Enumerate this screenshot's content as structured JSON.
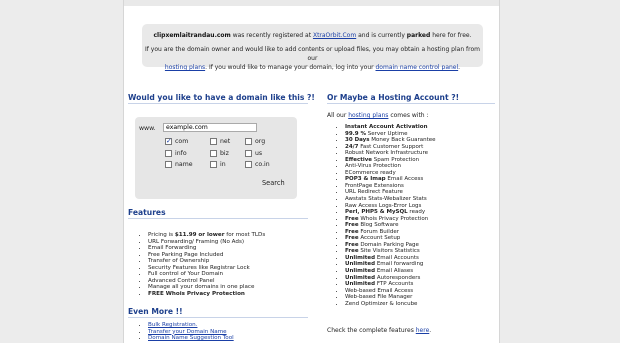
{
  "notice": {
    "domain": "clipxemlaitrandau.com",
    "text1": " was recently registered at ",
    "registrar": "XtraOrbit.Com",
    "text2": " and is currently ",
    "parked": "parked",
    "text3": " here for free.",
    "line2a": "If you are the domain owner and would like to add contents or upload files, you may obtain a hosting plan from our",
    "hosting_link": "hosting plans",
    "line3a": ". If you would like to manage your domain, log into your ",
    "control_link": "domain name control panel",
    "line3b": "."
  },
  "domain_search": {
    "heading": "Would you like to have a domain like this ?!",
    "www_label": "www.",
    "input_value": "example.com",
    "tlds": [
      {
        "label": "com",
        "checked": true
      },
      {
        "label": "net",
        "checked": false
      },
      {
        "label": "org",
        "checked": false
      },
      {
        "label": "info",
        "checked": false
      },
      {
        "label": "biz",
        "checked": false
      },
      {
        "label": "us",
        "checked": false
      },
      {
        "label": "name",
        "checked": false
      },
      {
        "label": "in",
        "checked": false
      },
      {
        "label": "co.in",
        "checked": false
      }
    ],
    "search_label": "Search"
  },
  "features": {
    "heading": "Features",
    "items": [
      {
        "pre": "Pricing is ",
        "bold": "$11.99 or lower",
        "post": " for most TLDs"
      },
      {
        "pre": "URL Forwarding/ Framing (No Ads)",
        "bold": "",
        "post": ""
      },
      {
        "pre": "Email Forwarding",
        "bold": "",
        "post": ""
      },
      {
        "pre": "Free Parking Page Included",
        "bold": "",
        "post": ""
      },
      {
        "pre": "Transfer of Ownership",
        "bold": "",
        "post": ""
      },
      {
        "pre": "Security Features like Registrar Lock",
        "bold": "",
        "post": ""
      },
      {
        "pre": "Full control of Your Domain",
        "bold": "",
        "post": ""
      },
      {
        "pre": "Advanced Control Panel",
        "bold": "",
        "post": ""
      },
      {
        "pre": "Manage all your domains in one place",
        "bold": "",
        "post": ""
      },
      {
        "pre": "",
        "bold": "FREE Whois Privacy Protection",
        "post": ""
      }
    ]
  },
  "even_more": {
    "heading": "Even More !!",
    "links": [
      "Bulk Registration.",
      "Transfer your Domain Name",
      "Domain Name Suggestion Tool"
    ]
  },
  "hosting": {
    "heading": "Or Maybe a Hosting Account ?!",
    "intro_pre": "All our ",
    "intro_link": "hosting plans",
    "intro_post": " comes with :",
    "items": [
      {
        "bold": "Instant Account Activation",
        "post": ""
      },
      {
        "bold": "99.9 %",
        "post": " Server Uptime"
      },
      {
        "bold": "30 Days",
        "post": " Money Back Guarantee"
      },
      {
        "bold": "24/7",
        "post": " Fast Customer Support"
      },
      {
        "bold": "",
        "post": "Robust Network Infrastructure"
      },
      {
        "bold": "Effective",
        "post": " Spam Protection"
      },
      {
        "bold": "",
        "post": "Anti-Virus Protection"
      },
      {
        "bold": "",
        "post": "ECommerce ready"
      },
      {
        "bold": "POP3 & Imap",
        "post": " Email Access"
      },
      {
        "bold": "",
        "post": "FrontPage Extensions"
      },
      {
        "bold": "",
        "post": "URL Redirect Feature"
      },
      {
        "bold": "",
        "post": "Awstats Stats-Webalizer Stats"
      },
      {
        "bold": "",
        "post": "Raw Access Logs-Error Logs"
      },
      {
        "bold": "Perl, PHP5 & MySQL",
        "post": " ready"
      },
      {
        "bold": "Free",
        "post": " Whois Privacy Protection"
      },
      {
        "bold": "Free",
        "post": " Blog Software"
      },
      {
        "bold": "Free",
        "post": " Forum Builder"
      },
      {
        "bold": "Free",
        "post": " Account Setup"
      },
      {
        "bold": "Free",
        "post": " Domain Parking Page"
      },
      {
        "bold": "Free",
        "post": " Site Visitors Statistics"
      },
      {
        "bold": "Unlimited",
        "post": " Email Accounts"
      },
      {
        "bold": "Unlimited",
        "post": " Email forwarding"
      },
      {
        "bold": "Unlimited",
        "post": " Email Aliases"
      },
      {
        "bold": "Unlimited",
        "post": " Autoresponders"
      },
      {
        "bold": "Unlimited",
        "post": " FTP Accounts"
      },
      {
        "bold": "",
        "post": "Web-based Email Access"
      },
      {
        "bold": "",
        "post": "Web-based File Manager"
      },
      {
        "bold": "",
        "post": "Zend Optimizer & Ioncube"
      }
    ],
    "outro_pre": "Check the complete features ",
    "outro_link": "here",
    "outro_post": "."
  }
}
